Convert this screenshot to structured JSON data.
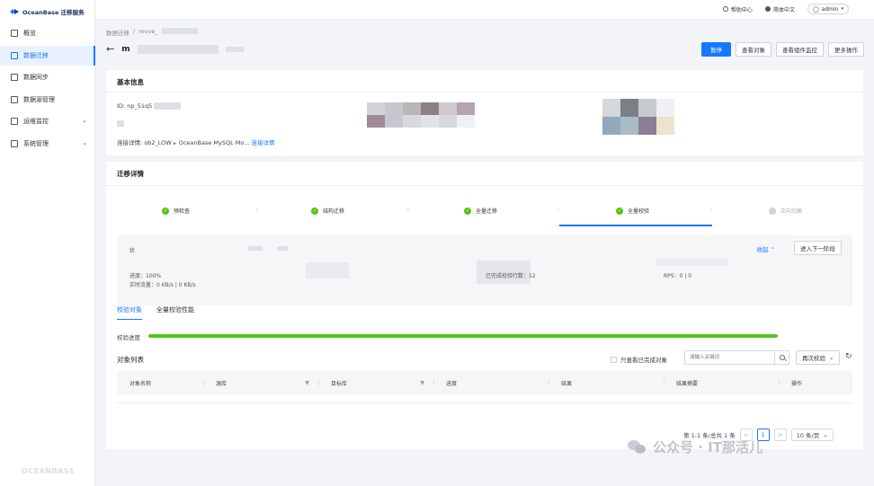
{
  "app": {
    "logo_text": "OceanBase 迁移服务",
    "footer_logo": "OCEANBASE"
  },
  "sidebar": {
    "items": [
      {
        "label": "概览",
        "icon": "grid-icon",
        "active": false
      },
      {
        "label": "数据迁移",
        "icon": "migrate-icon",
        "active": true
      },
      {
        "label": "数据同步",
        "icon": "sync-icon",
        "active": false
      },
      {
        "label": "数据源管理",
        "icon": "datasource-icon",
        "active": false
      },
      {
        "label": "运维监控",
        "icon": "monitor-icon",
        "active": false,
        "expandable": true
      },
      {
        "label": "系统管理",
        "icon": "settings-icon",
        "active": false,
        "expandable": true
      }
    ]
  },
  "topbar": {
    "help": "帮助中心",
    "language": "简体中文",
    "user": "admin"
  },
  "breadcrumb": {
    "root": "数据迁移",
    "sep": "/",
    "current": "move_"
  },
  "page": {
    "title_prefix": "m"
  },
  "actions": {
    "pause": "暂停",
    "view_objects": "查看对象",
    "view_monitor": "查看组件监控",
    "more": "更多操作"
  },
  "basic_info": {
    "title": "基本信息",
    "id_label": "ID:",
    "id_value": "np_51q5",
    "conn_label": "连接详情:",
    "conn_source": "ob2_LOW",
    "conn_arrow": "▶",
    "conn_target": "OceanBase MySQL Mo...",
    "conn_link": "连接详情"
  },
  "migration": {
    "title": "迁移详情",
    "steps": [
      {
        "label": "预检查",
        "status": "done"
      },
      {
        "label": "结构迁移",
        "status": "done"
      },
      {
        "label": "全量迁移",
        "status": "done"
      },
      {
        "label": "全量校验",
        "status": "done",
        "current": true
      },
      {
        "label": "正向切换",
        "status": "pending"
      }
    ],
    "stage": {
      "status_label": "状",
      "progress_text": "进度：100%",
      "throughput_text": "实时流量：0 KB/s | 0 KB/s",
      "verified_text": "已完成校验行数：12",
      "rps_text": "RPS：0 | 0",
      "collapse": "收起",
      "next": "进入下一阶段"
    },
    "tabs": [
      {
        "label": "校验对象",
        "active": true
      },
      {
        "label": "全量校验性能",
        "active": false
      }
    ],
    "progress_label": "校验进度",
    "progress_fraction": 1.0,
    "list_title": "对象列表",
    "only_unfinished": "只查看已完成对象",
    "search_placeholder": "请输入关键词",
    "recheck": "再次校验",
    "columns": [
      {
        "label": "对象名称",
        "filter": false
      },
      {
        "label": "源库",
        "filter": true
      },
      {
        "label": "目标库",
        "filter": true
      },
      {
        "label": "进度",
        "filter": false
      },
      {
        "label": "结果",
        "filter": false
      },
      {
        "label": "结果摘要",
        "filter": false
      },
      {
        "label": "操作",
        "filter": false
      }
    ],
    "pager": {
      "summary": "第 1-1 条/总共 1 条",
      "prev": "<",
      "current": "1",
      "next": ">",
      "size": "10 条/页"
    }
  },
  "watermark": {
    "text": "公众号 · IT那活儿"
  },
  "colors": {
    "primary": "#1677ff",
    "success": "#52c41a",
    "bg": "#f2f4f7"
  }
}
